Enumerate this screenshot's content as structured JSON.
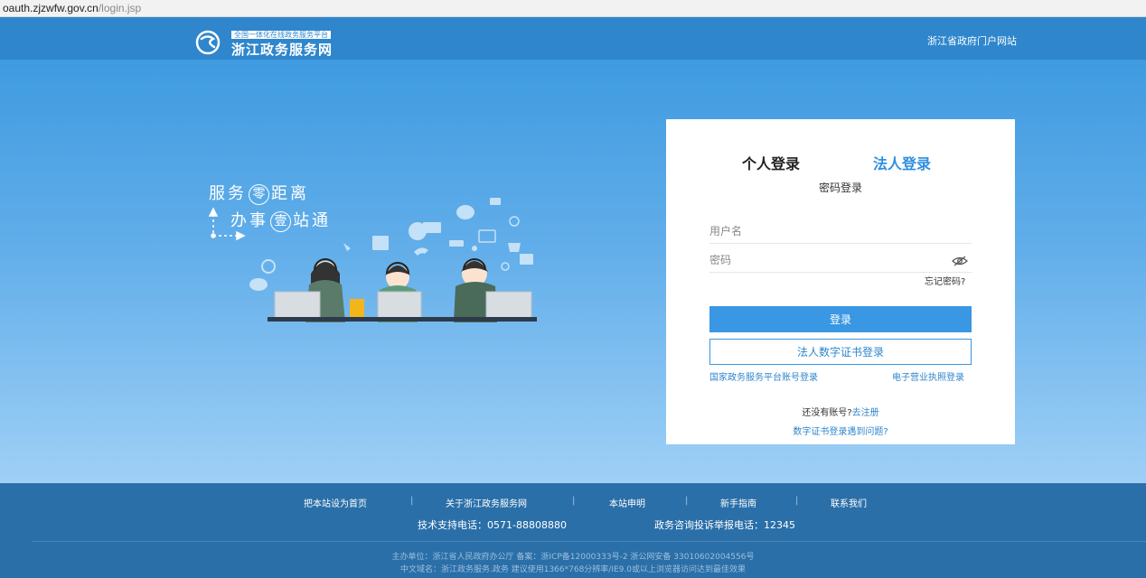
{
  "browser": {
    "url_host": "oauth.zjzwfw.gov.cn",
    "url_path": "/login.jsp"
  },
  "header": {
    "logo_tag": "全国一体化在线政务服务平台",
    "logo_name": "浙江政务服务网",
    "portal_link": "浙江省政府门户网站"
  },
  "hero": {
    "slogan1": {
      "pre": "服务",
      "circle": "零",
      "post": "距离"
    },
    "slogan2": {
      "pre": "办事",
      "circle": "壹",
      "post": "站通"
    }
  },
  "login": {
    "tab_personal": "个人登录",
    "tab_corp": "法人登录",
    "subtitle": "密码登录",
    "username_placeholder": "用户名",
    "password_placeholder": "密码",
    "forgot": "忘记密码?",
    "login_button": "登录",
    "cert_button": "法人数字证书登录",
    "national_link": "国家政务服务平台账号登录",
    "license_link": "电子营业执照登录",
    "no_account": "还没有账号?",
    "register": "去注册",
    "cert_help": "数字证书登录遇到问题?"
  },
  "footer": {
    "nav": [
      "把本站设为首页",
      "关于浙江政务服务网",
      "本站申明",
      "新手指南",
      "联系我们"
    ],
    "tech_hotline": "技术支持电话：0571-88808880",
    "complaint_hotline": "政务咨询投诉举报电话：12345",
    "info1": "主办单位：浙江省人民政府办公厅    备案：浙ICP备12000333号-2    浙公网安备 33010602004556号",
    "info2": "中文域名：浙江政务服务.政务    建议使用1366*768分辨率/IE9.0或以上浏览器访问达到最佳效果"
  },
  "colors": {
    "brand_blue": "#2f86cc",
    "button_blue": "#3a97e3",
    "footer_bg": "#2a6fa8"
  }
}
